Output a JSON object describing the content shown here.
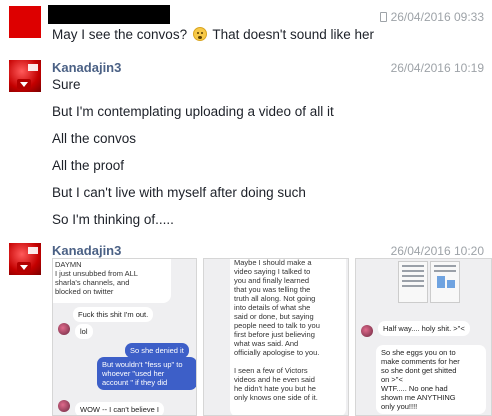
{
  "message1": {
    "timestamp": "26/04/2016 09:33",
    "text_before_emoji": "May I see the convos?",
    "text_after_emoji": "That doesn't sound like her"
  },
  "message2": {
    "username": "Kanadajin3",
    "timestamp": "26/04/2016 10:19",
    "lines": [
      "Sure",
      "But I'm contemplating uploading a video of all it",
      "All the convos",
      "All the proof",
      "But I can't live with myself after doing such",
      "So I'm thinking of....."
    ]
  },
  "message3": {
    "username": "Kanadajin3",
    "timestamp": "26/04/2016 10:20",
    "shot1": {
      "top_lines": [
        "DAYMN",
        "I just unsubbed from ALL",
        "sharla's channels, and",
        "blocked on twitter"
      ],
      "bubble1": "Fuck this shit I'm out.",
      "bubble2": "lol",
      "blue1": "So she denied it",
      "blue2_lines": [
        "But wouldn't \"fess up\" to",
        "whoever \"used her",
        "account \" if they did"
      ],
      "bubble3": "WOW -- I can't believe I"
    },
    "shot2": {
      "lines": [
        "Maybe I should make a",
        "video saying I talked to",
        "you and finally learned",
        "that you was telling the",
        "truth all along. Not going",
        "into details of what she",
        "said or done, but saying",
        "people need to talk to you",
        "first before just believing",
        "what was said. And",
        "officially apologise to you.",
        "",
        "I seen a few of Victors",
        "videos and he even said",
        "he didn't hate you but he",
        "only knows one side of it."
      ]
    },
    "shot3": {
      "bubble1": "Half way.... holy shit. >\"<",
      "bubble2_lines": [
        "So she eggs you on to",
        "make comments for her",
        "so she dont get shitted",
        "on >\"<",
        "WTF..... No one had",
        "shown me ANYTHING",
        "only you!!!!"
      ]
    }
  }
}
